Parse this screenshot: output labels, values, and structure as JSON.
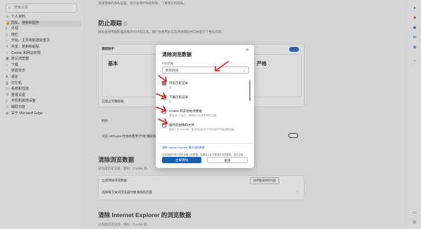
{
  "sidebar": {
    "search_placeholder": "搜索设置",
    "items": [
      {
        "icon": "user-icon",
        "label": "个人资料"
      },
      {
        "icon": "lock-icon",
        "label": "隐私、搜索和服务"
      },
      {
        "icon": "appearance-icon",
        "label": "外观"
      },
      {
        "icon": "sidebar-icon",
        "label": "侧栏"
      },
      {
        "icon": "start-icon",
        "label": "开始、主页和新建标签页"
      },
      {
        "icon": "share-icon",
        "label": "共享、复制和粘贴"
      },
      {
        "icon": "cookie-icon",
        "label": "Cookie 和网站权限"
      },
      {
        "icon": "browser-icon",
        "label": "默认浏览器"
      },
      {
        "icon": "download-icon",
        "label": "下载"
      },
      {
        "icon": "family-icon",
        "label": "家庭安全"
      },
      {
        "icon": "language-icon",
        "label": "语言"
      },
      {
        "icon": "printer-icon",
        "label": "打印机"
      },
      {
        "icon": "system-icon",
        "label": "系统和性能"
      },
      {
        "icon": "reset-icon",
        "label": "重置设置"
      },
      {
        "icon": "phone-icon",
        "label": "手机和其他设备"
      },
      {
        "icon": "accessibility-icon",
        "label": "辅助功能"
      },
      {
        "icon": "edge-icon",
        "label": "关于 Microsoft Edge"
      }
    ]
  },
  "main": {
    "intro_text": "选择需要的隐私设置，我们会保护你的隐私。了解我们的隐私。",
    "intro_link": "了解我们的隐私",
    "tracking": {
      "title": "防止跟踪",
      "desc": "网站会使用跟踪器收集你的浏览信息。我们会使用此信息改进网站并向你显示个性化内容。",
      "card_label": "跟踪防护",
      "option_basic": "基本",
      "option_strict": "严格",
      "blocked_label": "已阻止的跟踪器",
      "exceptions_label": "例外",
      "inprivate_label": "浏览 InPrivate 时始终使用\"严格\"跟踪防护"
    },
    "clear": {
      "title": "清除浏览数据",
      "desc": "这包括历史记录、密码、Cookie 等。",
      "now_label": "立即清除浏览数据",
      "choose_button": "选择要清除的内容",
      "on_close_label": "选择每次关闭浏览器时要清除的内容"
    },
    "ie": {
      "title": "清除 Internet Explorer 的浏览数据",
      "desc": "这包括历史记录、密码、Cookie 等。"
    }
  },
  "dialog": {
    "title": "清除浏览数据",
    "range_label": "时间范围",
    "range_value": "所有时间",
    "items": [
      {
        "label": "浏览历史记录",
        "desc": "无",
        "checked": true
      },
      {
        "label": "下载历史记录",
        "desc": "无",
        "checked": false
      },
      {
        "label": "Cookie 和其他站点数据",
        "desc": "来自 45 个站点。将使你从大多数网站注销。",
        "checked": false
      },
      {
        "label": "缓存的图像和文件",
        "desc": "释放少于 319 MB。某些网站在你下次访问时可能加载较慢。",
        "checked": false
      }
    ],
    "ie_link": "清除 Internet Explorer 模式浏览数据",
    "note": "这将清除所有已同步设备上的数据。若要仅从此设备清除浏览数据，请先注销。",
    "clear_button": "立即清除",
    "cancel_button": "取消"
  },
  "colors": {
    "accent": "#1a5fb4",
    "arrow": "#d81e1e",
    "toggle_on": "#1a5fb4"
  }
}
